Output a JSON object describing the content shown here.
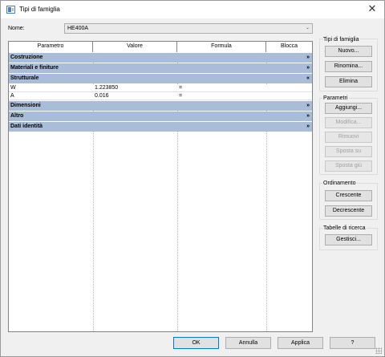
{
  "window": {
    "title": "Tipi di famiglia",
    "close_glyph": "✕"
  },
  "name": {
    "label": "Nome:",
    "value": "HE400A"
  },
  "grid": {
    "columns": [
      "Parametro",
      "Valore",
      "Formula",
      "Blocca"
    ],
    "groups": [
      {
        "label": "Costruzione",
        "expander": "»",
        "rows": []
      },
      {
        "label": "Materiali e finiture",
        "expander": "»",
        "rows": []
      },
      {
        "label": "Strutturale",
        "expander": "«",
        "rows": [
          {
            "parametro": "W",
            "valore": "1.223850",
            "formula": "=",
            "blocca": ""
          },
          {
            "parametro": "A",
            "valore": "0.016",
            "formula": "=",
            "blocca": ""
          }
        ]
      },
      {
        "label": "Dimensioni",
        "expander": "»",
        "rows": []
      },
      {
        "label": "Altro",
        "expander": "»",
        "rows": []
      },
      {
        "label": "Dati identità",
        "expander": "»",
        "rows": []
      }
    ]
  },
  "sidebar": {
    "family_types": {
      "title": "Tipi di famiglia",
      "new": "Nuovo...",
      "rename": "Rinomina...",
      "delete": "Elimina"
    },
    "parameters": {
      "title": "Parametri",
      "add": "Aggiungi...",
      "modify": "Modifica...",
      "remove": "Rimuovi",
      "move_up": "Sposta su",
      "move_down": "Sposta giù"
    },
    "sorting": {
      "title": "Ordinamento",
      "ascending": "Crescente",
      "descending": "Decrescente"
    },
    "lookup": {
      "title": "Tabelle di ricerca",
      "manage": "Gestisci..."
    }
  },
  "footer": {
    "ok": "OK",
    "cancel": "Annulla",
    "apply": "Applica",
    "help": "?"
  },
  "colors": {
    "group_row": "#a9bdd8",
    "accent_border": "#0078d7"
  }
}
